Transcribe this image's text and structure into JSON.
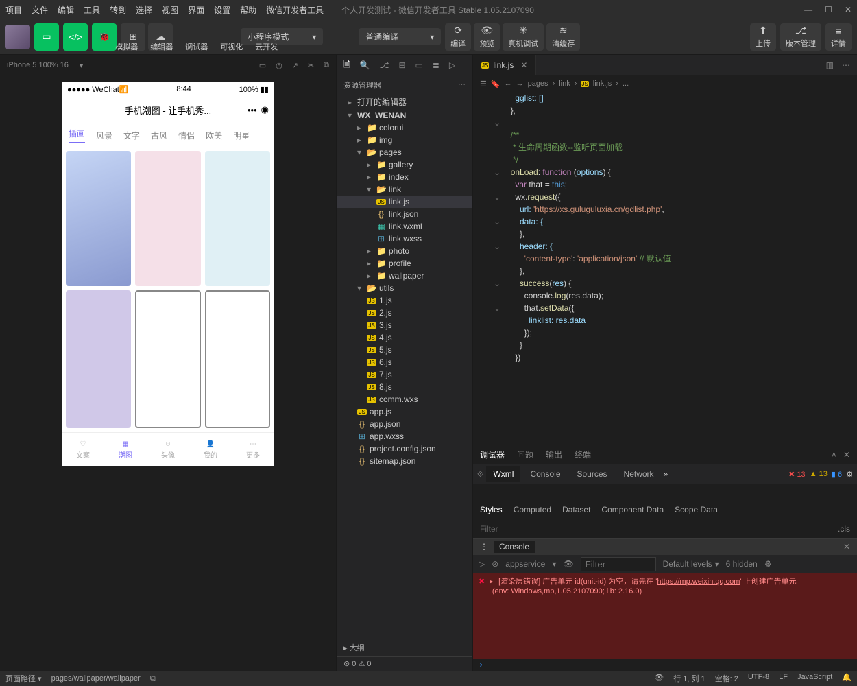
{
  "menu": [
    "项目",
    "文件",
    "编辑",
    "工具",
    "转到",
    "选择",
    "视图",
    "界面",
    "设置",
    "帮助",
    "微信开发者工具"
  ],
  "window_title": "个人开发测试 - 微信开发者工具 Stable 1.05.2107090",
  "toolbar": {
    "groups": [
      "模拟器",
      "编辑器",
      "调试器",
      "可视化",
      "云开发"
    ],
    "mode": "小程序模式",
    "compile": "普通编译",
    "actions": [
      "编译",
      "预览",
      "真机调试",
      "清缓存"
    ],
    "right": [
      "上传",
      "版本管理",
      "详情"
    ]
  },
  "simulator": {
    "device": "iPhone 5 100% 16",
    "status_left": "●●●●● WeChat",
    "status_time": "8:44",
    "status_batt": "100%",
    "page_title": "手机潮图 - 让手机秀...",
    "tabs": [
      "插画",
      "风景",
      "文字",
      "古风",
      "情侣",
      "欧美",
      "明星"
    ],
    "nav": [
      "文案",
      "潮图",
      "头像",
      "我的",
      "更多"
    ]
  },
  "explorer": {
    "title": "资源管理器",
    "section_open": "打开的编辑器",
    "project": "WX_WENAN",
    "tree": {
      "colorui": "colorui",
      "img": "img",
      "pages": "pages",
      "gallery": "gallery",
      "index": "index",
      "link": "link",
      "linkjs": "link.js",
      "linkjson": "link.json",
      "linkwxml": "link.wxml",
      "linkwxss": "link.wxss",
      "photo": "photo",
      "profile": "profile",
      "wallpaper": "wallpaper",
      "utils": "utils",
      "u1": "1.js",
      "u2": "2.js",
      "u3": "3.js",
      "u4": "4.js",
      "u5": "5.js",
      "u6": "6.js",
      "u7": "7.js",
      "u8": "8.js",
      "commwxs": "comm.wxs",
      "appjs": "app.js",
      "appjson": "app.json",
      "appwxss": "app.wxss",
      "projconf": "project.config.json",
      "sitemap": "sitemap.json"
    },
    "outline": "大纲",
    "outline_stats": "⊘ 0 ⚠ 0"
  },
  "editor": {
    "tab": "link.js",
    "breadcrumb": [
      "pages",
      "link",
      "link.js",
      "..."
    ],
    "code": {
      "l1": "    gglist: []",
      "l2": "  },",
      "l3": "",
      "l4": "  /**",
      "l5": "   * 生命周期函数--监听页面加载",
      "l6": "   */",
      "l7_a": "  onLoad",
      "l7_b": ": ",
      "l7_c": "function",
      "l7_d": " (",
      "l7_e": "options",
      "l7_f": ") {",
      "l8_a": "    var",
      "l8_b": " that = ",
      "l8_c": "this",
      "l8_d": ";",
      "l9_a": "    wx.",
      "l9_b": "request",
      "l9_c": "({",
      "l10_a": "      url: ",
      "l10_b": "'https://xs.guluguluxia.cn/gdlist.php'",
      "l10_c": ",",
      "l11": "      data: {",
      "l12": "      },",
      "l13": "      header: {",
      "l14_a": "        ",
      "l14_b": "'content-type'",
      "l14_c": ": ",
      "l14_d": "'application/json'",
      "l14_e": " // 默认值",
      "l15": "      },",
      "l16_a": "      ",
      "l16_b": "success",
      "l16_c": "(",
      "l16_d": "res",
      "l16_e": ") {",
      "l17_a": "        console.",
      "l17_b": "log",
      "l17_c": "(res.data);",
      "l18_a": "        that.",
      "l18_b": "setData",
      "l18_c": "({",
      "l19": "          linklist: res.data",
      "l20": "        });",
      "l21": "      }",
      "l22": "    })"
    }
  },
  "debugger": {
    "tabs": [
      "调试器",
      "问题",
      "输出",
      "终端"
    ],
    "main_tabs": [
      "Wxml",
      "Console",
      "Sources",
      "Network"
    ],
    "badges": {
      "err": "13",
      "warn": "13",
      "info": "6"
    },
    "style_tabs": [
      "Styles",
      "Computed",
      "Dataset",
      "Component Data",
      "Scope Data"
    ],
    "filter": "Filter",
    "cls": ".cls",
    "console_title": "Console",
    "appservice": "appservice",
    "filter2": "Filter",
    "levels": "Default levels",
    "hidden": "6 hidden",
    "err_line1_a": "[渲染层错误] 广告单元 id(unit-id) 为空，请先在 '",
    "err_line1_link": "https://mp.weixin.qq.com",
    "err_line1_b": "' 上创建广告单元",
    "err_line2": "(env: Windows,mp,1.05.2107090; lib: 2.16.0)"
  },
  "statusbar": {
    "path_label": "页面路径",
    "path": "pages/wallpaper/wallpaper",
    "line": "行 1, 列 1",
    "spaces": "空格: 2",
    "enc": "UTF-8",
    "eol": "LF",
    "lang": "JavaScript"
  }
}
